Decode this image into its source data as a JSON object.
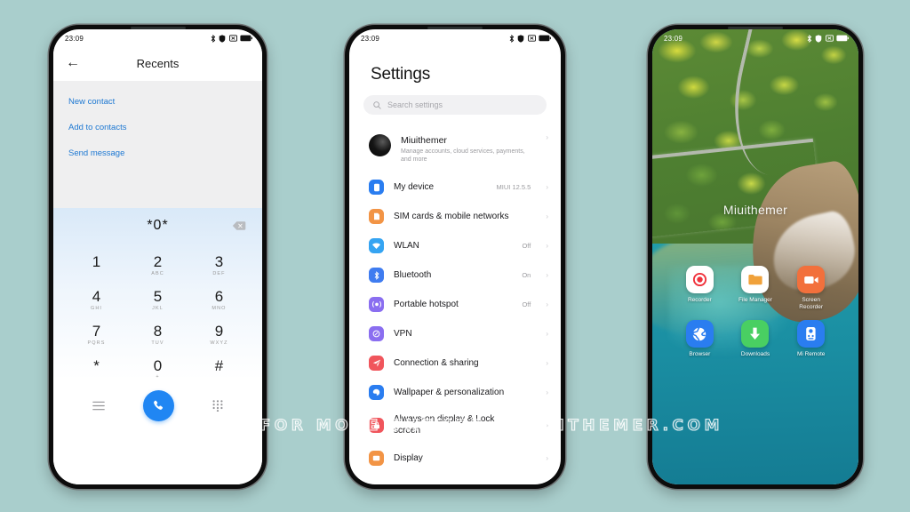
{
  "background_color": "#a9cecc",
  "watermark": "VISIT FOR MORE THEMES - MIUITHEMER.COM",
  "status_bar": {
    "time": "23:09",
    "icons": [
      "bluetooth-icon",
      "shield-icon",
      "alarm-icon",
      "battery-icon"
    ]
  },
  "phone1": {
    "app_bar": {
      "back_label": "←",
      "title": "Recents"
    },
    "contact_actions": [
      {
        "label": "New contact"
      },
      {
        "label": "Add to contacts"
      },
      {
        "label": "Send message"
      }
    ],
    "dialer": {
      "number": "*0*",
      "backspace_icon": "backspace-icon",
      "keys": [
        {
          "digit": "1",
          "letters": ""
        },
        {
          "digit": "2",
          "letters": "ABC"
        },
        {
          "digit": "3",
          "letters": "DEF"
        },
        {
          "digit": "4",
          "letters": "GHI"
        },
        {
          "digit": "5",
          "letters": "JKL"
        },
        {
          "digit": "6",
          "letters": "MNO"
        },
        {
          "digit": "7",
          "letters": "PQRS"
        },
        {
          "digit": "8",
          "letters": "TUV"
        },
        {
          "digit": "9",
          "letters": "WXYZ"
        },
        {
          "digit": "*",
          "letters": ""
        },
        {
          "digit": "0",
          "letters": "+"
        },
        {
          "digit": "#",
          "letters": ""
        }
      ],
      "actions": {
        "menu_icon": "menu-icon",
        "call_icon": "phone-call-icon",
        "keypad_icon": "keypad-icon",
        "call_button_color": "#2086f3"
      }
    }
  },
  "phone2": {
    "title": "Settings",
    "search": {
      "placeholder": "Search settings",
      "icon": "search-icon"
    },
    "account": {
      "name": "Miuithemer",
      "subtitle": "Manage accounts, cloud services, payments, and more",
      "avatar": "account-avatar"
    },
    "rows": [
      {
        "label": "My device",
        "value": "MIUI 12.5.5",
        "icon": "device-icon",
        "color": "#2a7df0"
      },
      {
        "label": "SIM cards & mobile networks",
        "value": "",
        "icon": "sim-icon",
        "color": "#f29445"
      },
      {
        "label": "WLAN",
        "value": "Off",
        "icon": "wifi-icon",
        "color": "#35a4f2"
      },
      {
        "label": "Bluetooth",
        "value": "On",
        "icon": "bluetooth-icon",
        "color": "#3f7cf0"
      },
      {
        "label": "Portable hotspot",
        "value": "Off",
        "icon": "hotspot-icon",
        "color": "#8a6ef0"
      },
      {
        "label": "VPN",
        "value": "",
        "icon": "vpn-icon",
        "color": "#8a6ef0"
      },
      {
        "label": "Connection & sharing",
        "value": "",
        "icon": "share-icon",
        "color": "#f0555c"
      },
      {
        "label": "Wallpaper & personalization",
        "value": "",
        "icon": "wallpaper-icon",
        "color": "#2a7df0"
      },
      {
        "label": "Always-on display & Lock screen",
        "value": "",
        "icon": "lock-icon",
        "color": "#f0555c"
      },
      {
        "label": "Display",
        "value": "",
        "icon": "display-icon",
        "color": "#f29445"
      }
    ],
    "chevron": "›"
  },
  "phone3": {
    "clock_label": "Miuithemer",
    "apps": [
      {
        "name": "Recorder",
        "icon": "recorder-icon",
        "bg": "#ffffff",
        "fg": "#f0323c"
      },
      {
        "name": "File Manager",
        "icon": "folder-icon",
        "bg": "#ffffff",
        "fg": "#f0a13a"
      },
      {
        "name": "Screen Recorder",
        "icon": "video-camera-icon",
        "bg": "#f2703c",
        "fg": "#ffffff"
      },
      {
        "name": "Browser",
        "icon": "globe-icon",
        "bg": "#2a7df0",
        "fg": "#ffffff"
      },
      {
        "name": "Downloads",
        "icon": "download-arrow-icon",
        "bg": "#49cf62",
        "fg": "#ffffff"
      },
      {
        "name": "Mi Remote",
        "icon": "remote-icon",
        "bg": "#2a7df0",
        "fg": "#ffffff"
      }
    ]
  }
}
